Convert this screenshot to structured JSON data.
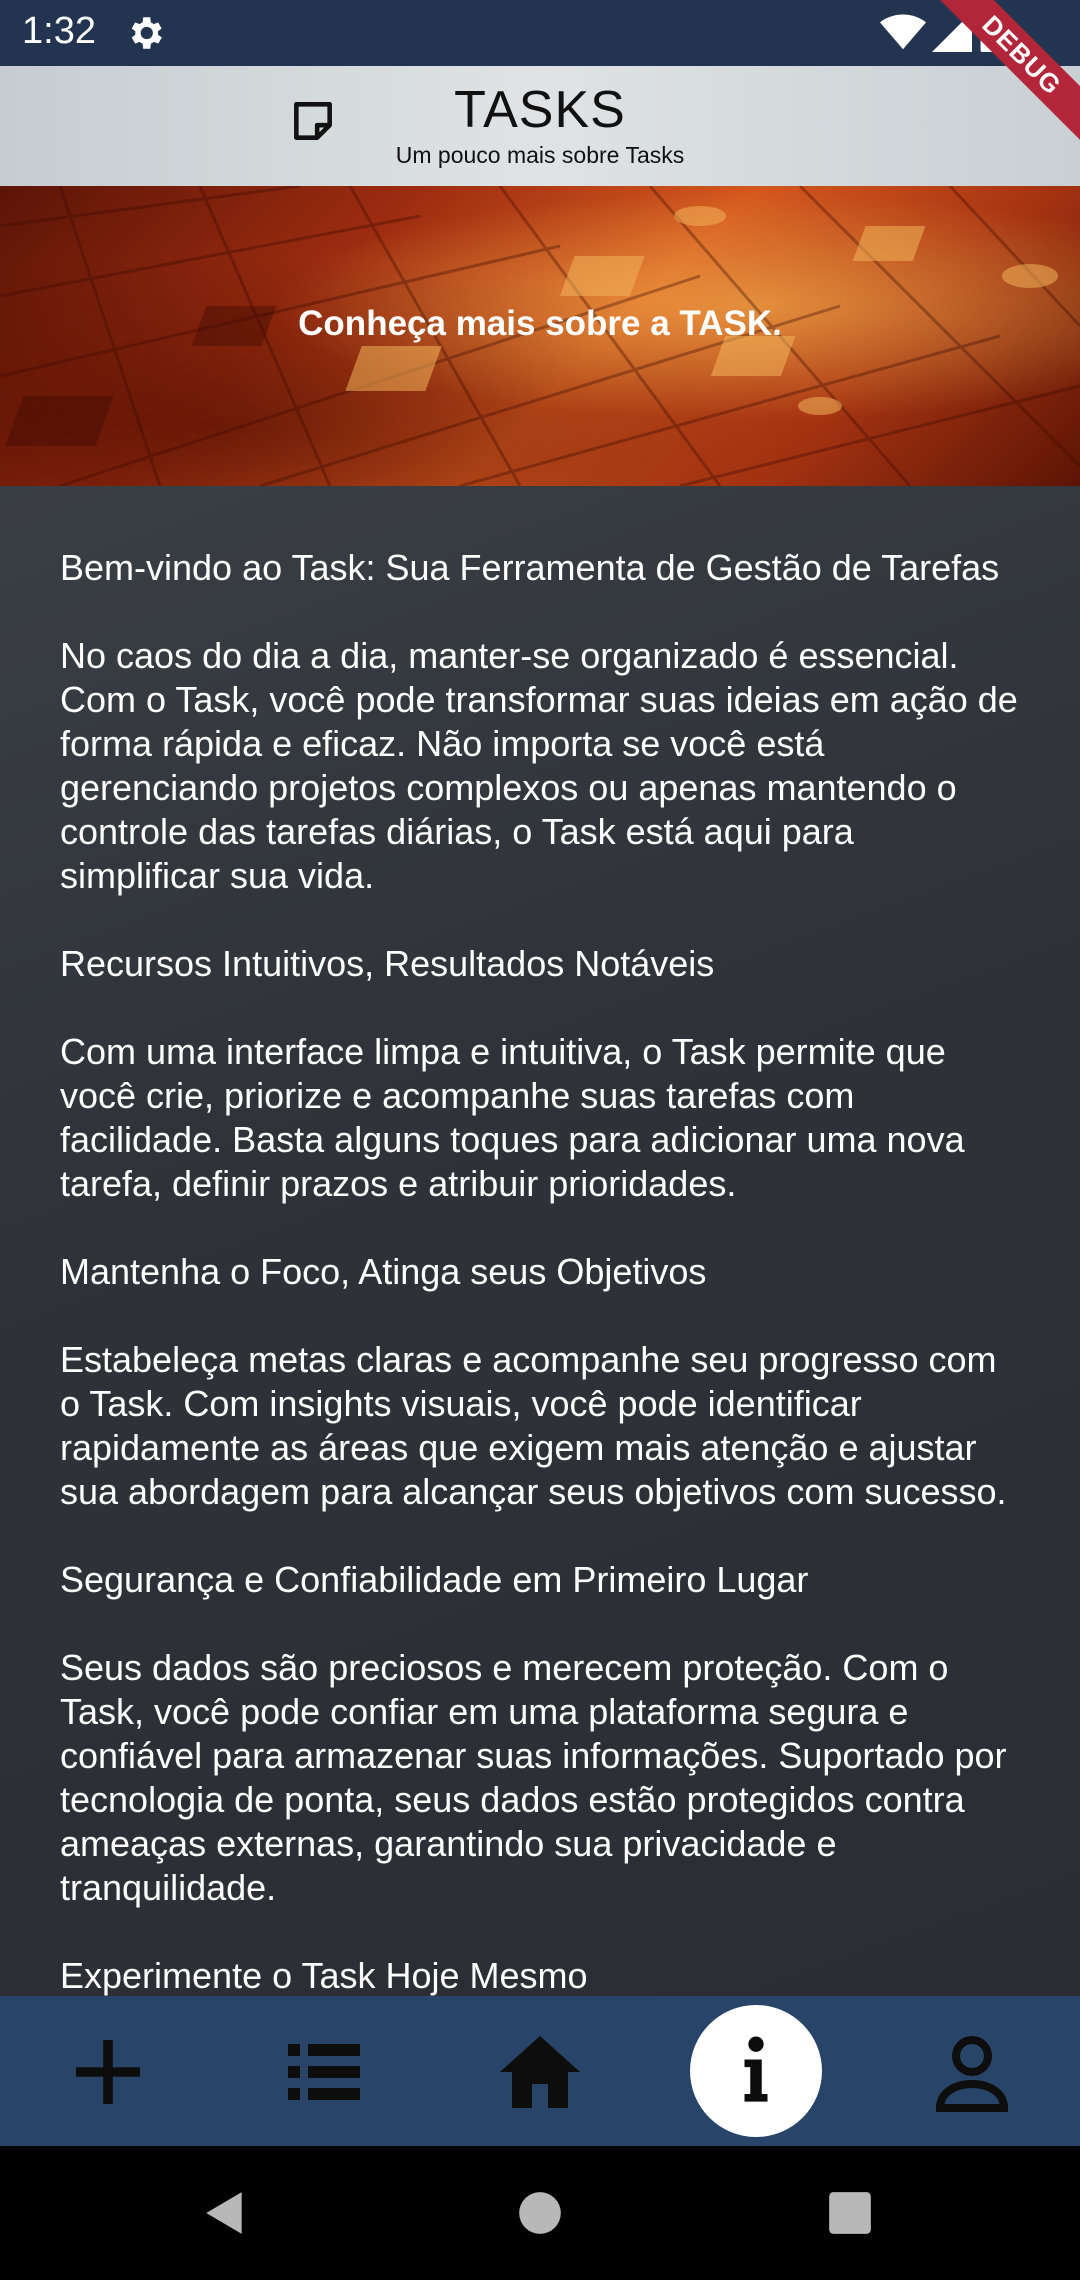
{
  "status_bar": {
    "time": "1:32",
    "icons": [
      "gear-icon",
      "wifi-icon",
      "signal-icon",
      "battery-icon"
    ],
    "debug_label": "DEBUG"
  },
  "app_bar": {
    "icon": "note-icon",
    "title": "TASKS",
    "subtitle": "Um pouco mais sobre Tasks",
    "background": "#d6dbde"
  },
  "hero": {
    "text": "Conheça mais sobre a TASK.",
    "accent": "#d4581e"
  },
  "content": {
    "paragraphs": [
      "Bem-vindo ao Task: Sua Ferramenta de Gestão de Tarefas",
      "No caos do dia a dia, manter-se organizado é essencial. Com o Task, você pode transformar suas ideias em ação de forma rápida e eficaz. Não importa se você está gerenciando projetos complexos ou apenas mantendo o controle das tarefas diárias, o Task está aqui para simplificar sua vida.",
      "Recursos Intuitivos, Resultados Notáveis",
      "Com uma interface limpa e intuitiva, o Task permite que você crie, priorize e acompanhe suas tarefas com facilidade. Basta alguns toques para adicionar uma nova tarefa, definir prazos e atribuir prioridades.",
      "Mantenha o Foco, Atinga seus Objetivos",
      "Estabeleça metas claras e acompanhe seu progresso com o Task. Com insights visuais, você pode identificar rapidamente as áreas que exigem mais atenção e ajustar sua abordagem para alcançar seus objetivos com sucesso.",
      "Segurança e Confiabilidade em Primeiro Lugar",
      "Seus dados são preciosos e merecem proteção. Com o Task, você pode confiar em uma plataforma segura e confiável para armazenar suas informações. Suportado por tecnologia de ponta, seus dados estão protegidos contra ameaças externas, garantindo sua privacidade e tranquilidade.",
      "Experimente o Task Hoje Mesmo"
    ]
  },
  "bottom_nav": {
    "items": [
      {
        "icon": "add-icon"
      },
      {
        "icon": "list-icon"
      },
      {
        "icon": "home-icon"
      },
      {
        "icon": "info-icon",
        "active": true
      },
      {
        "icon": "person-icon"
      }
    ],
    "background": "#28466e"
  },
  "system_nav": {
    "icons": [
      "back-icon",
      "home-circle-icon",
      "recents-icon"
    ]
  }
}
